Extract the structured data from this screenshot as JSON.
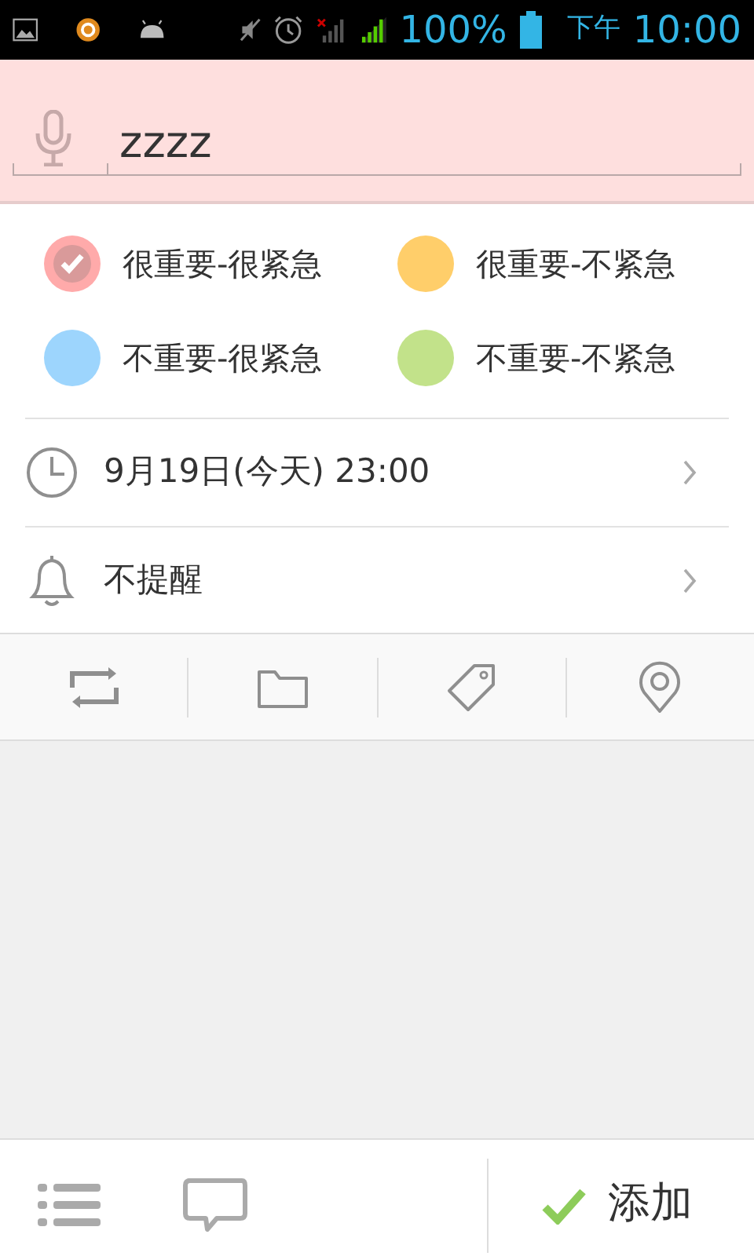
{
  "status_bar": {
    "battery": "100%",
    "period": "下午",
    "time": "10:00"
  },
  "title_field": {
    "value": "zzzz"
  },
  "priorities": [
    {
      "label": "很重要-很紧急",
      "color": "#ffaaaa",
      "selected": true
    },
    {
      "label": "很重要-不紧急",
      "color": "#ffce6a",
      "selected": false
    },
    {
      "label": "不重要-很紧急",
      "color": "#9dd5fd",
      "selected": false
    },
    {
      "label": "不重要-不紧急",
      "color": "#c2e28a",
      "selected": false
    }
  ],
  "settings": [
    {
      "kind": "date",
      "text": "9月19日(今天) 23:00"
    },
    {
      "kind": "reminder",
      "text": "不提醒"
    }
  ],
  "bottom_bar": {
    "confirm_label": "添加"
  }
}
